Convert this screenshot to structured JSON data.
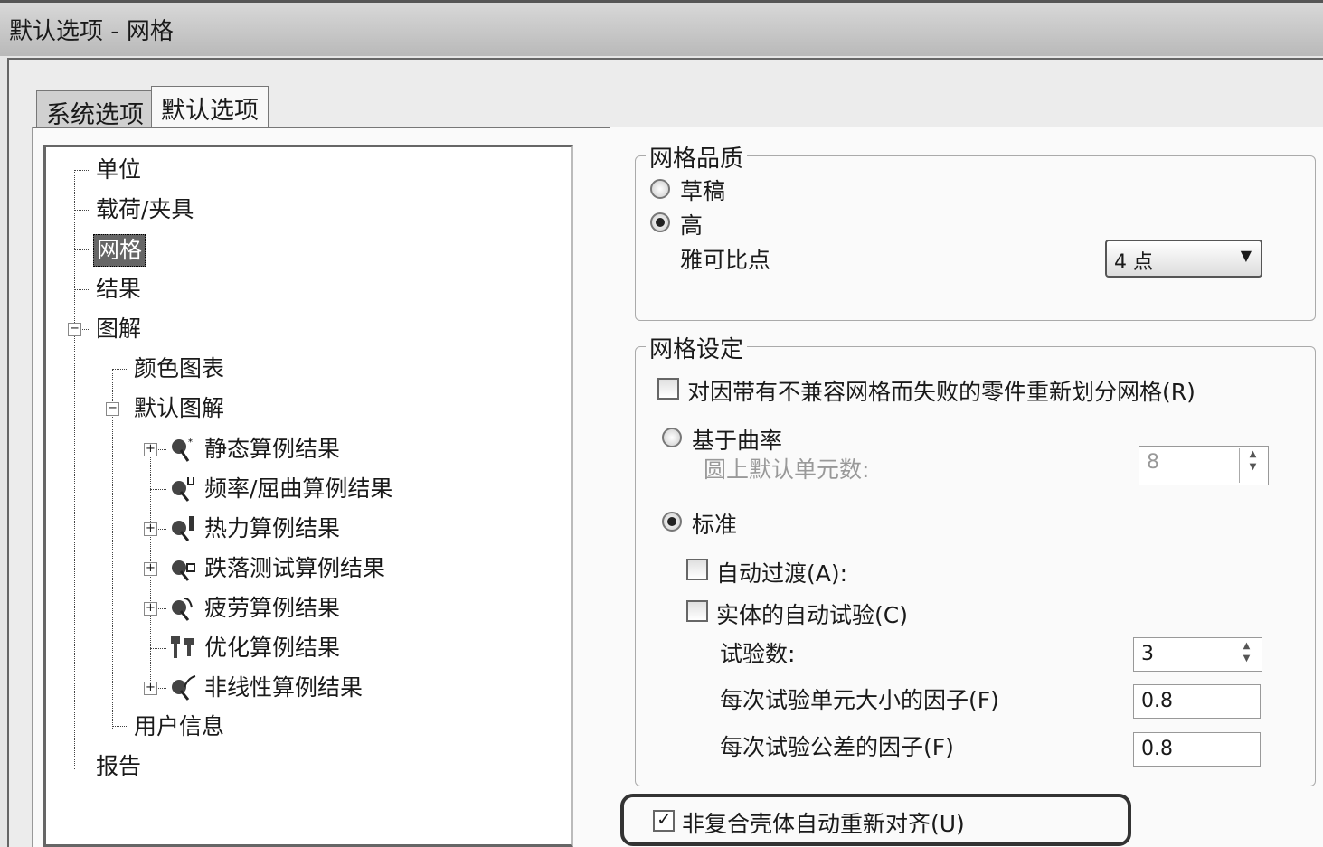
{
  "window": {
    "title": "默认选项 - 网格"
  },
  "tabs": [
    {
      "label": "系统选项"
    },
    {
      "label": "默认选项"
    }
  ],
  "tree": {
    "items": [
      "单位",
      "载荷/夹具",
      "网格",
      "结果",
      "图解",
      "颜色图表",
      "默认图解",
      "静态算例结果",
      "频率/屈曲算例结果",
      "热力算例结果",
      "跌落测试算例结果",
      "疲劳算例结果",
      "优化算例结果",
      "非线性算例结果",
      "用户信息",
      "报告"
    ],
    "selected": "网格"
  },
  "mesh_quality": {
    "title": "网格品质",
    "draft": "草稿",
    "high": "高",
    "selected": "高",
    "jacobian_label": "雅可比点",
    "jacobian_value": "4 点"
  },
  "mesh_settings": {
    "title": "网格设定",
    "remesh": "对因带有不兼容网格而失败的零件重新划分网格(R)",
    "remesh_checked": false,
    "curvature": "基于曲率",
    "circle_elements_label": "圆上默认单元数:",
    "circle_elements_value": "8",
    "standard": "标准",
    "selected": "标准",
    "auto_transition": "自动过渡(A):",
    "auto_trials": "实体的自动试验(C)",
    "trials_label": "试验数:",
    "trials_value": "3",
    "size_factor_label": "每次试验单元大小的因子(F)",
    "size_factor_value": "0.8",
    "tol_factor_label": "每次试验公差的因子(F)",
    "tol_factor_value": "0.8"
  },
  "realign": {
    "label": "非复合壳体自动重新对齐(U)",
    "checked": true
  }
}
